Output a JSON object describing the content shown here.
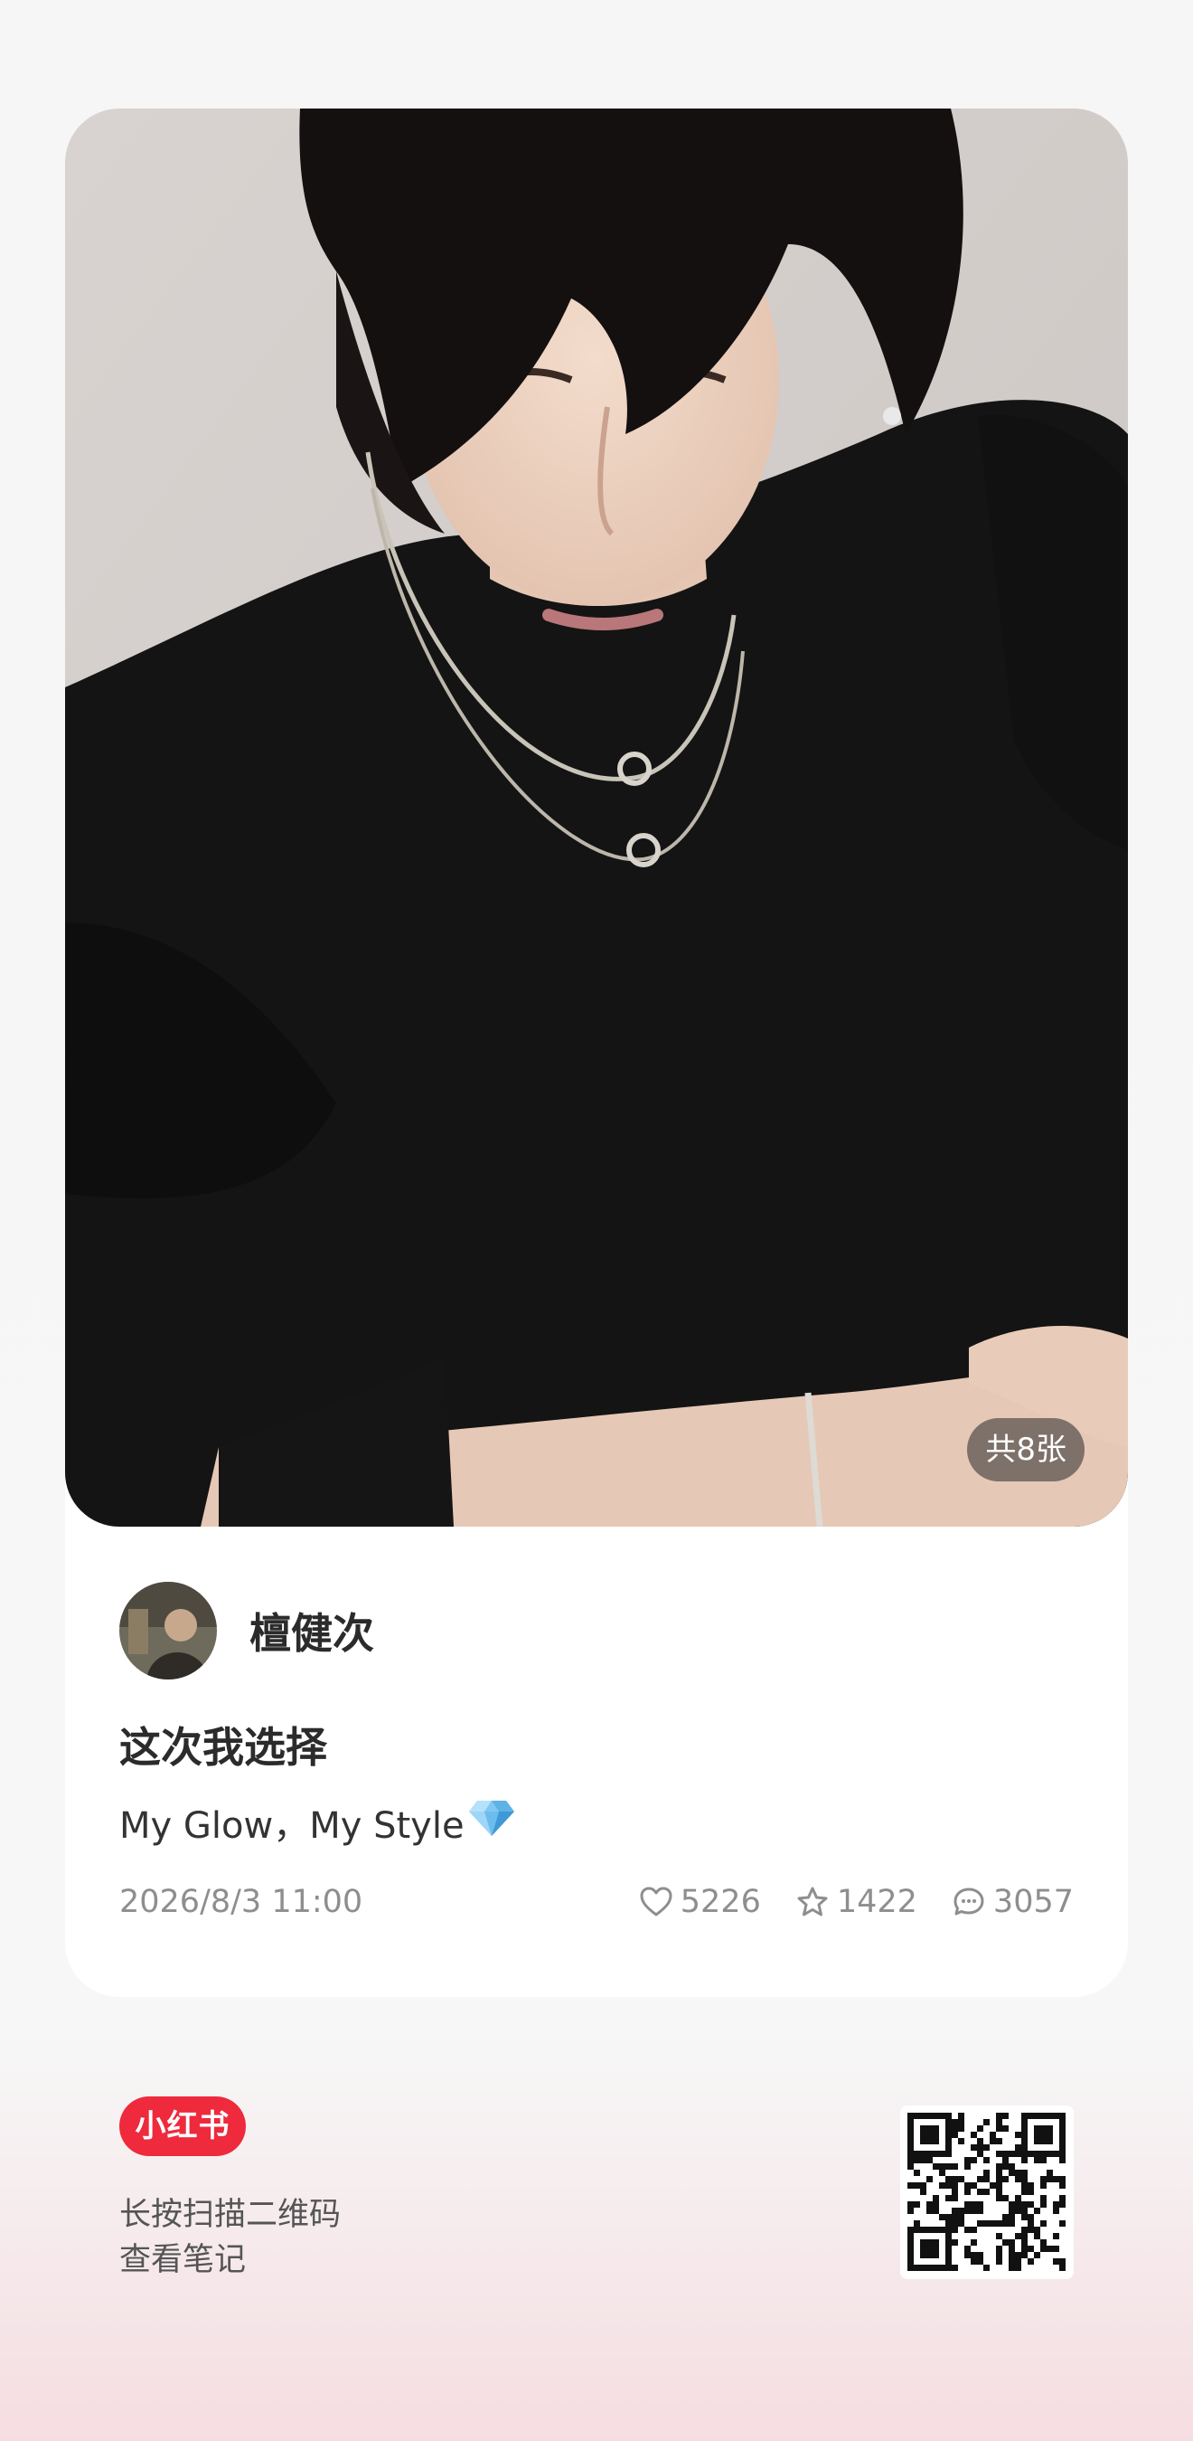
{
  "post": {
    "image_count_label": "共8张",
    "author_name": "檀健次",
    "title": "这次我选择",
    "description": "My Glow，My Style",
    "date": "2026/8/3 11:00",
    "likes": "5226",
    "collects": "1422",
    "comments": "3057"
  },
  "footer": {
    "logo_text": "小红书",
    "line1": "长按扫描二维码",
    "line2": "查看笔记"
  },
  "icons": {
    "like": "heart-icon",
    "collect": "star-icon",
    "comment": "comment-icon",
    "emoji": "gem-icon"
  },
  "colors": {
    "brand": "#ee2a3c",
    "badge_bg": "#3c3c3c",
    "meta_text": "#8e8e8e"
  }
}
